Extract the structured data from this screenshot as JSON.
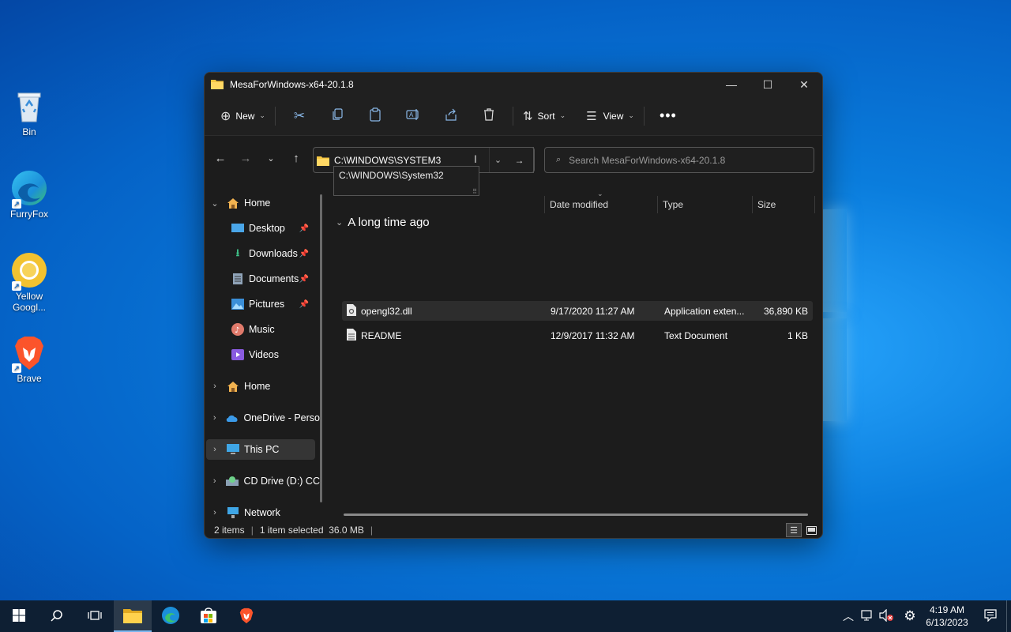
{
  "desktop": {
    "icons": [
      {
        "label": "Bin"
      },
      {
        "label": "FurryFox"
      },
      {
        "label": "Yellow Googl..."
      },
      {
        "label": "Brave"
      }
    ]
  },
  "window": {
    "title": "MesaForWindows-x64-20.1.8",
    "toolbar": {
      "new_label": "New",
      "sort_label": "Sort",
      "view_label": "View"
    },
    "address": {
      "value": "C:\\WINDOWS\\SYSTEM3",
      "suggestion": "C:\\WINDOWS\\System32"
    },
    "search": {
      "placeholder": "Search MesaForWindows-x64-20.1.8"
    },
    "sidebar": {
      "items": [
        {
          "label": "Home"
        },
        {
          "label": "Desktop"
        },
        {
          "label": "Downloads"
        },
        {
          "label": "Documents"
        },
        {
          "label": "Pictures"
        },
        {
          "label": "Music"
        },
        {
          "label": "Videos"
        },
        {
          "label": "Home"
        },
        {
          "label": "OneDrive - Perso"
        },
        {
          "label": "This PC"
        },
        {
          "label": "CD Drive (D:) CC"
        },
        {
          "label": "Network"
        }
      ]
    },
    "columns": {
      "date": "Date modified",
      "type": "Type",
      "size": "Size"
    },
    "group": "A long time ago",
    "files": [
      {
        "name": "opengl32.dll",
        "date": "9/17/2020 11:27 AM",
        "type": "Application exten...",
        "size": "36,890 KB"
      },
      {
        "name": "README",
        "date": "12/9/2017 11:32 AM",
        "type": "Text Document",
        "size": "1 KB"
      }
    ],
    "status": {
      "items": "2 items",
      "selected": "1 item selected  36.0 MB"
    }
  },
  "taskbar": {
    "time": "4:19 AM",
    "date": "6/13/2023"
  },
  "colors": {
    "accent": "#7ab7f0",
    "window_bg": "#1c1c1c",
    "folder_yellow": "#f4c542"
  }
}
